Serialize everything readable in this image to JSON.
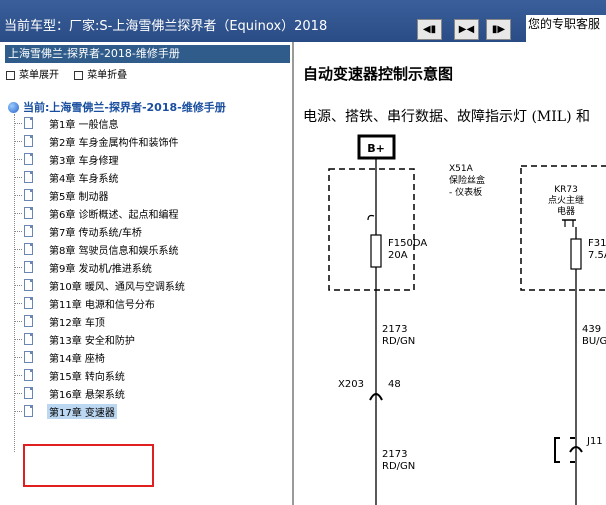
{
  "topbar": {
    "car_label": "当前车型：",
    "car_value": "厂家:S-上海雪佛兰探界者（Equinox）2018",
    "greeting": "您的专职客服"
  },
  "sidebar": {
    "header": "上海雪佛兰-探界者-2018-维修手册",
    "expand_label": "菜单展开",
    "collapse_label": "菜单折叠",
    "root_label": "当前:上海雪佛兰-探界者-2018-维修手册",
    "chapters": [
      "第1章 一般信息",
      "第2章 车身金属构件和装饰件",
      "第3章 车身修理",
      "第4章 车身系统",
      "第5章 制动器",
      "第6章 诊断概述、起点和编程",
      "第7章 传动系统/车桥",
      "第8章 驾驶员信息和娱乐系统",
      "第9章 发动机/推进系统",
      "第10章 暖风、通风与空调系统",
      "第11章 电源和信号分布",
      "第12章 车顶",
      "第13章 安全和防护",
      "第14章 座椅",
      "第15章 转向系统",
      "第16章 悬架系统",
      "第17章 变速器"
    ],
    "selected_index": 16
  },
  "content": {
    "title": "自动变速器控制示意图",
    "description": "电源、搭铁、串行数据、故障指示灯 (MIL) 和",
    "schematic": {
      "b_plus": "B+",
      "fuse_box_code": "X51A",
      "fuse_box_name_1": "保险丝盒",
      "fuse_box_name_2": "- 仪表板",
      "fuse1_code": "F150DA",
      "fuse1_rating": "20A",
      "wire1_num": "2173",
      "wire1_color": "RD/GN",
      "connector": "X203",
      "connector_pin": "48",
      "wire2_num": "2173",
      "wire2_color": "RD/GN",
      "relay_code": "KR73",
      "relay_name_1": "点火主继",
      "relay_name_2": "电器",
      "fuse2_code": "F31",
      "fuse2_rating": "7.5A",
      "wire3_num": "439",
      "wire3_color": "BU/G",
      "connector2": "J11"
    }
  }
}
